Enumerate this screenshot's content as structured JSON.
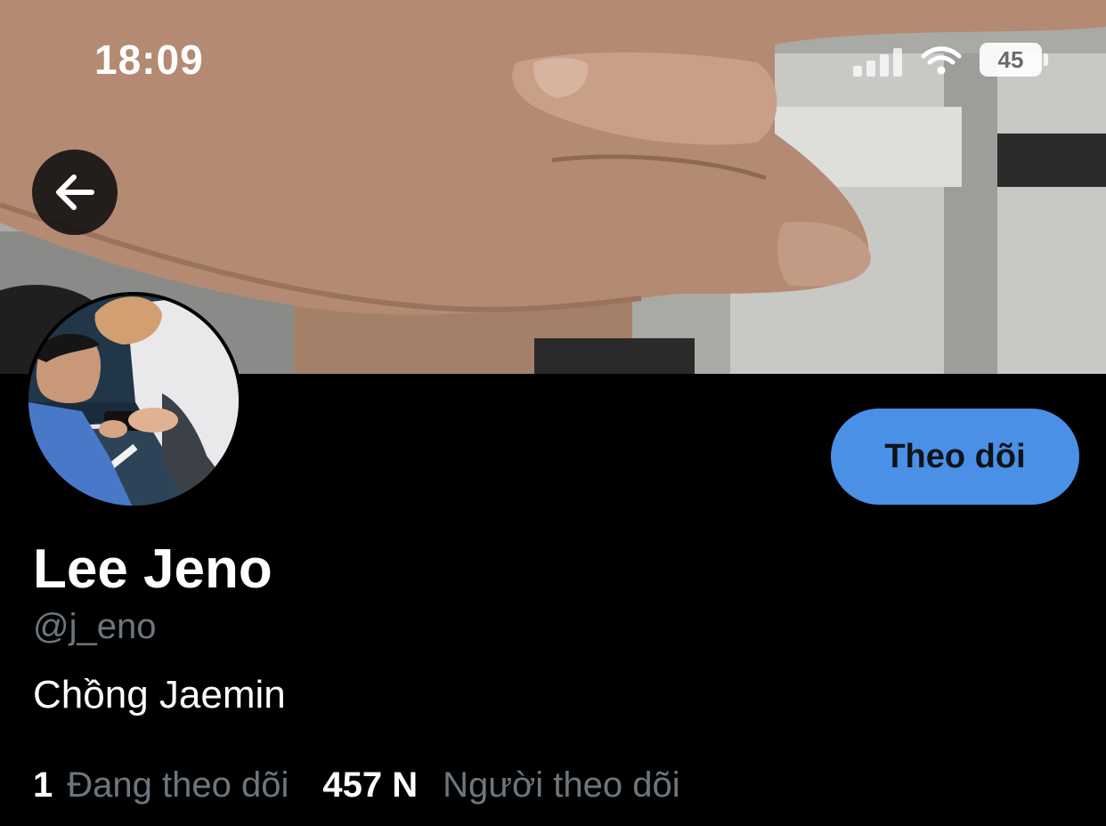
{
  "status_bar": {
    "time": "18:09",
    "battery": "45",
    "signal_icon": "cellular-signal-icon",
    "wifi_icon": "wifi-icon"
  },
  "header": {
    "back_icon": "arrow-left-icon"
  },
  "profile": {
    "display_name": "Lee Jeno",
    "handle": "@j_eno",
    "bio": "Chồng Jaemin",
    "follow_label": "Theo dõi",
    "following_count": "1",
    "following_label": "Đang theo dõi",
    "followers_count": "457 N",
    "followers_label": "Người theo dõi"
  },
  "colors": {
    "background": "#000000",
    "accent": "#4a90e6",
    "secondary_text": "#6e767d"
  }
}
